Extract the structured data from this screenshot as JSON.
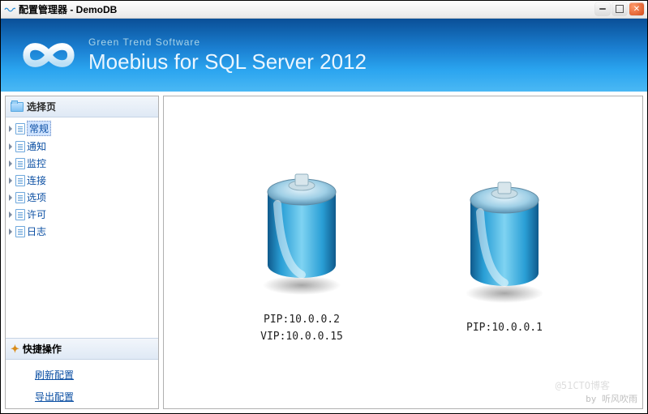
{
  "window": {
    "title": "配置管理器  - DemoDB"
  },
  "banner": {
    "subtitle": "Green Trend Software",
    "title": "Moebius for SQL Server 2012"
  },
  "sidebar": {
    "select_header": "选择页",
    "items": [
      {
        "label": "常规",
        "selected": true
      },
      {
        "label": "通知",
        "selected": false
      },
      {
        "label": "监控",
        "selected": false
      },
      {
        "label": "连接",
        "selected": false
      },
      {
        "label": "选项",
        "selected": false
      },
      {
        "label": "许可",
        "selected": false
      },
      {
        "label": "日志",
        "selected": false
      }
    ],
    "quick_header": "快捷操作",
    "quick_links": [
      {
        "label": "刷新配置"
      },
      {
        "label": "导出配置"
      }
    ]
  },
  "main": {
    "nodes": [
      {
        "pip": "PIP:10.0.0.2",
        "vip": "VIP:10.0.0.15"
      },
      {
        "pip": "PIP:10.0.0.1",
        "vip": ""
      }
    ]
  },
  "watermark_small": "by 听风吹雨",
  "watermark_faint": "@51CTO博客"
}
